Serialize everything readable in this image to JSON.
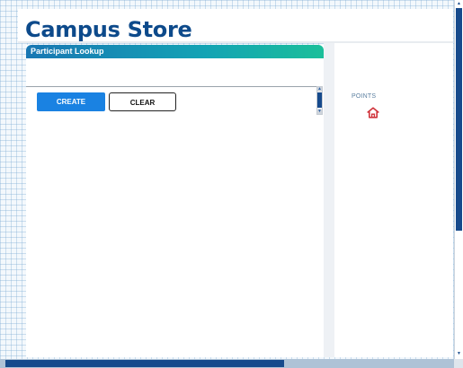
{
  "header": {
    "title": "Campus Store"
  },
  "lookup_panel": {
    "title": "Participant Lookup",
    "buttons": {
      "create": "CREATE",
      "clear": "CLEAR"
    }
  },
  "points_panel": {
    "label": "POINTS",
    "icon": "home-icon"
  },
  "colors": {
    "brand_blue": "#0d4a8b",
    "header_gradient": [
      "#1977b3",
      "#1bbf9a"
    ],
    "create_button": "#1a82e2",
    "home_icon": "#d0323a"
  }
}
